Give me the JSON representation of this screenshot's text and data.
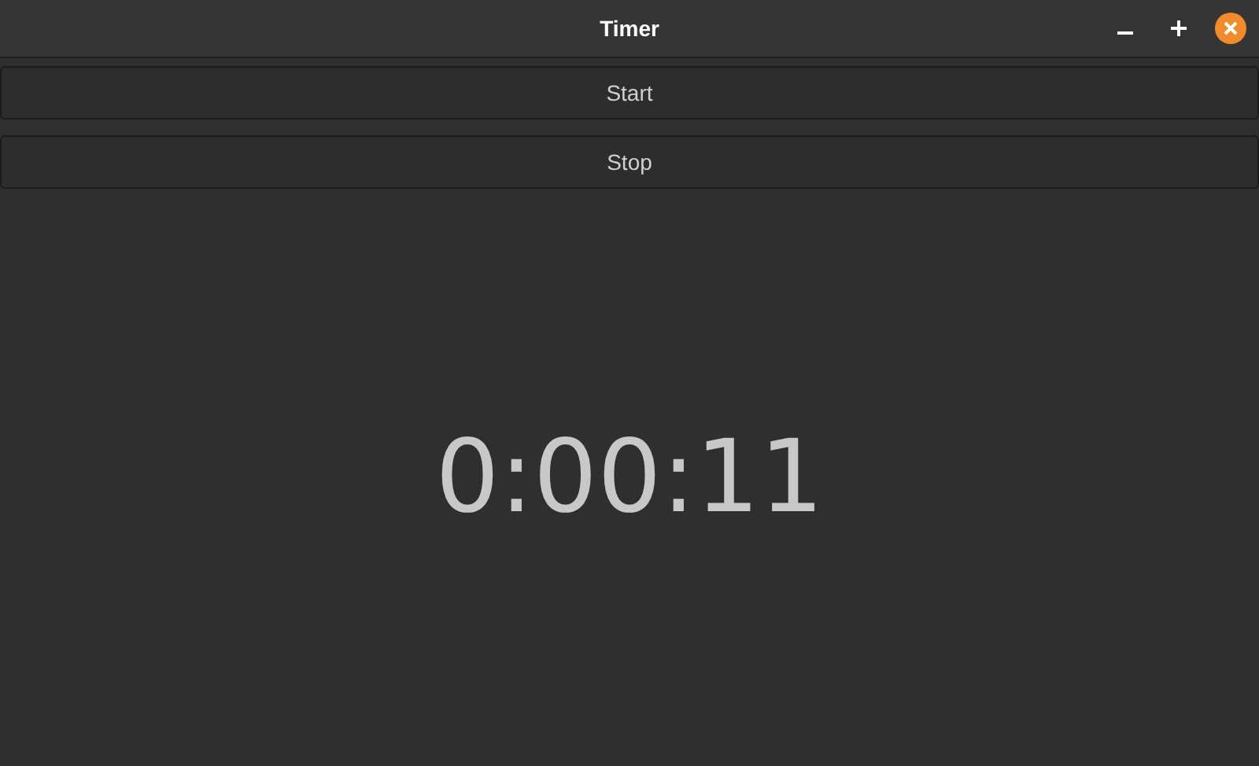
{
  "window": {
    "title": "Timer"
  },
  "buttons": [
    "Start",
    "Stop"
  ],
  "time": "0:00:11"
}
